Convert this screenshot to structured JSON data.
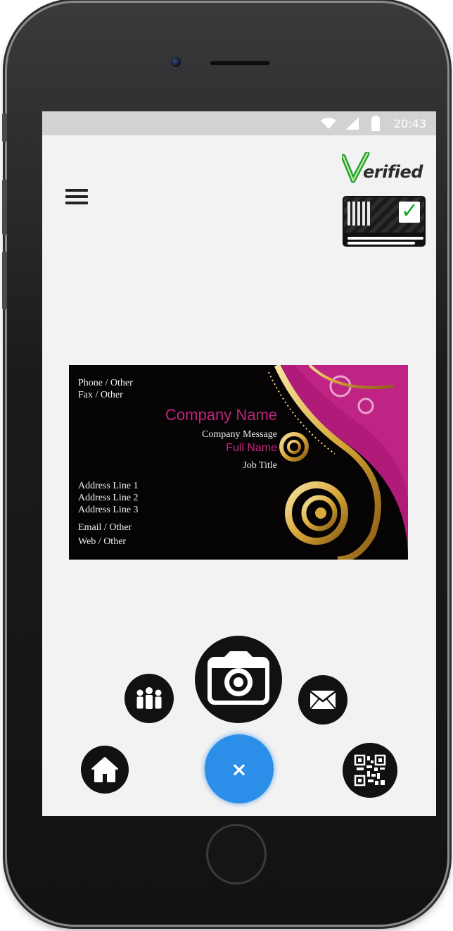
{
  "status_bar": {
    "time": "20:43",
    "icons": [
      "wifi-icon",
      "signal-icon",
      "battery-icon"
    ]
  },
  "header": {
    "menu_icon": "hamburger-menu-icon",
    "verified_logo": "Verified",
    "id_card_icon": "verified-id-card-icon"
  },
  "business_card": {
    "phone": "Phone / Other",
    "fax": "Fax / Other",
    "company_name": "Company Name",
    "company_message": "Company Message",
    "full_name": "Full Name",
    "job_title": "Job Title",
    "address_line_1": "Address Line 1",
    "address_line_2": "Address Line 2",
    "address_line_3": "Address Line 3",
    "email": "Email / Other",
    "web": "Web / Other",
    "colors": {
      "background": "#050303",
      "accent_pink": "#c0247f",
      "gold": "#d9b24a"
    }
  },
  "fab_menu": {
    "close_label": "×",
    "items": [
      "home-icon",
      "contacts-icon",
      "camera-icon",
      "mail-icon",
      "qr-code-icon"
    ],
    "colors": {
      "main": "#2b8ee8",
      "items": "#111111"
    }
  }
}
